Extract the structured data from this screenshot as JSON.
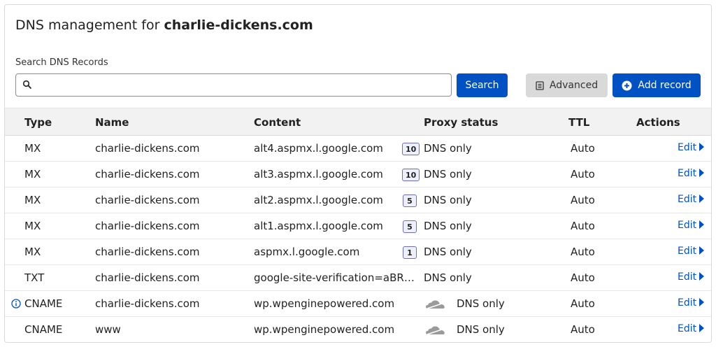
{
  "header": {
    "title_prefix": "DNS management for",
    "domain": "charlie-dickens.com"
  },
  "search": {
    "label": "Search DNS Records",
    "value": "",
    "placeholder": "",
    "search_button": "Search",
    "advanced_button": "Advanced",
    "add_button": "Add record"
  },
  "table": {
    "columns": [
      "Type",
      "Name",
      "Content",
      "Proxy status",
      "TTL",
      "Actions"
    ],
    "rows": [
      {
        "type": "MX",
        "name": "charlie-dickens.com",
        "content": "alt4.aspmx.l.google.com",
        "priority": "10",
        "proxy": "DNS only",
        "ttl": "Auto",
        "action": "Edit"
      },
      {
        "type": "MX",
        "name": "charlie-dickens.com",
        "content": "alt3.aspmx.l.google.com",
        "priority": "10",
        "proxy": "DNS only",
        "ttl": "Auto",
        "action": "Edit"
      },
      {
        "type": "MX",
        "name": "charlie-dickens.com",
        "content": "alt2.aspmx.l.google.com",
        "priority": "5",
        "proxy": "DNS only",
        "ttl": "Auto",
        "action": "Edit"
      },
      {
        "type": "MX",
        "name": "charlie-dickens.com",
        "content": "alt1.aspmx.l.google.com",
        "priority": "5",
        "proxy": "DNS only",
        "ttl": "Auto",
        "action": "Edit"
      },
      {
        "type": "MX",
        "name": "charlie-dickens.com",
        "content": "aspmx.l.google.com",
        "priority": "1",
        "proxy": "DNS only",
        "ttl": "Auto",
        "action": "Edit"
      },
      {
        "type": "TXT",
        "name": "charlie-dickens.com",
        "content": "google-site-verification=aBR_…",
        "proxy": "DNS only",
        "ttl": "Auto",
        "action": "Edit"
      },
      {
        "type": "CNAME",
        "name": "charlie-dickens.com",
        "content": "wp.wpenginepowered.com",
        "proxy": "DNS only",
        "ttl": "Auto",
        "action": "Edit",
        "cloud_icon": "grey-cloud-icon",
        "info_icon": "info-icon"
      },
      {
        "type": "CNAME",
        "name": "www",
        "content": "wp.wpenginepowered.com",
        "proxy": "DNS only",
        "ttl": "Auto",
        "action": "Edit",
        "cloud_icon": "grey-cloud-icon"
      }
    ]
  },
  "colors": {
    "primary": "#0051c3",
    "secondary_button": "#d9d9d9",
    "header_bg": "#f2f2f2"
  }
}
